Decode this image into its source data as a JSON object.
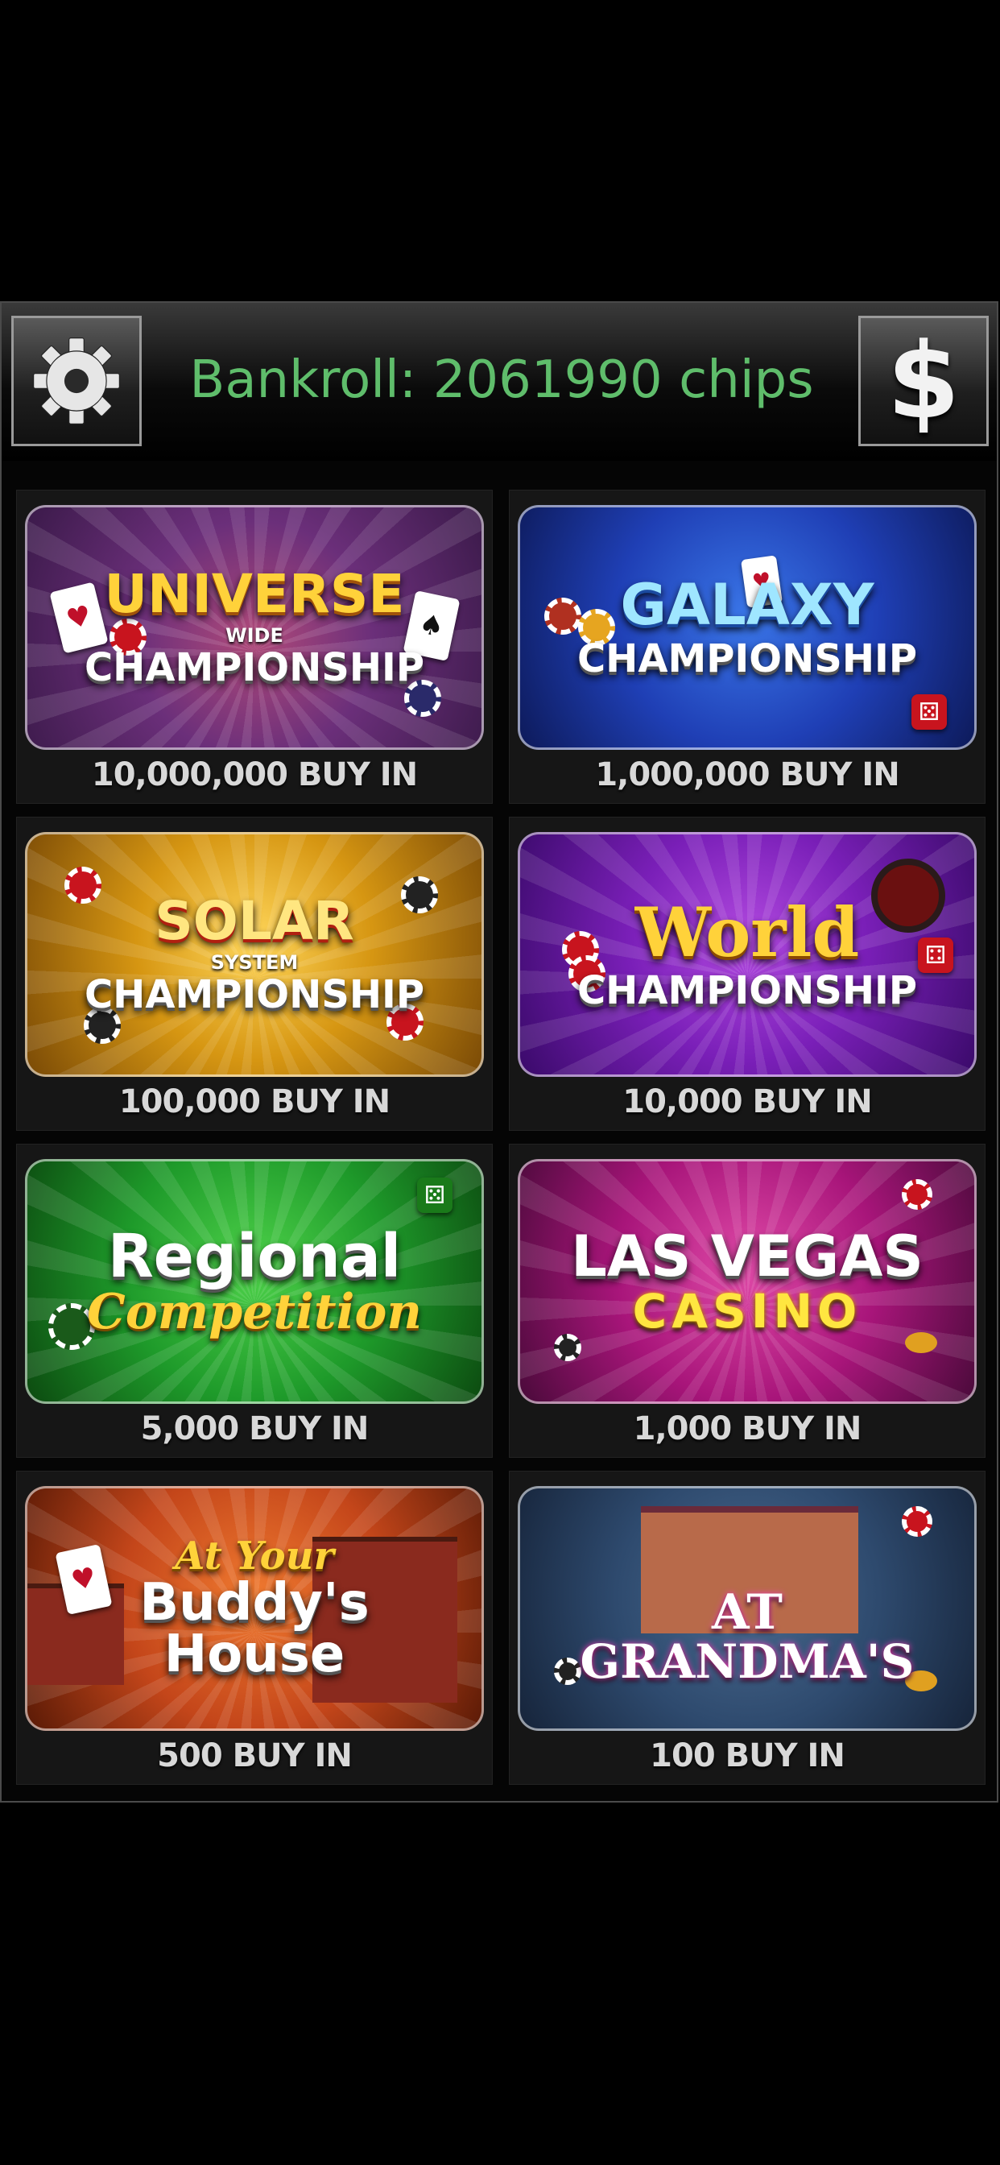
{
  "header": {
    "bankroll_text": "Bankroll: 2061990 chips",
    "settings_icon": "gear-icon",
    "cash_icon": "dollar-icon",
    "cash_symbol": "$"
  },
  "colors": {
    "bankroll_text": "#5fbd6b",
    "buyin_text": "#d8d8d8",
    "panel_border": "#4a4a4a"
  },
  "tournaments": [
    {
      "id": "universe",
      "title_line1": "UNIVERSE",
      "title_line2": "WIDE",
      "title_line3": "CHAMPIONSHIP",
      "buy_in": "10,000,000 BUY IN",
      "bg_color": "#6b2f7a"
    },
    {
      "id": "galaxy",
      "title_line1": "GALAXY",
      "title_line2": "CHAMPIONSHIP",
      "buy_in": "1,000,000 BUY IN",
      "bg_color": "#1f3fb5"
    },
    {
      "id": "solar",
      "title_line1": "SOLAR",
      "title_line2": "SYSTEM",
      "title_line3": "CHAMPIONSHIP",
      "buy_in": "100,000 BUY IN",
      "bg_color": "#d69612"
    },
    {
      "id": "world",
      "title_line1": "World",
      "title_line2": "CHAMPIONSHIP",
      "buy_in": "10,000 BUY IN",
      "bg_color": "#7a1fb8"
    },
    {
      "id": "regional",
      "title_line1": "Regional",
      "title_line2": "Competition",
      "buy_in": "5,000 BUY IN",
      "bg_color": "#1e9a2a"
    },
    {
      "id": "las-vegas",
      "title_line1": "LAS VEGAS",
      "title_line2": "CASINO",
      "buy_in": "1,000 BUY IN",
      "bg_color": "#a8157a"
    },
    {
      "id": "buddys-house",
      "title_line1": "At Your",
      "title_line2": "Buddy's",
      "title_line3": "House",
      "buy_in": "500 BUY IN",
      "bg_color": "#c4461a"
    },
    {
      "id": "grandmas",
      "title_line1": "AT",
      "title_line2": "GRANDMA'S",
      "buy_in": "100 BUY IN",
      "bg_color": "#2e4a6e"
    }
  ]
}
